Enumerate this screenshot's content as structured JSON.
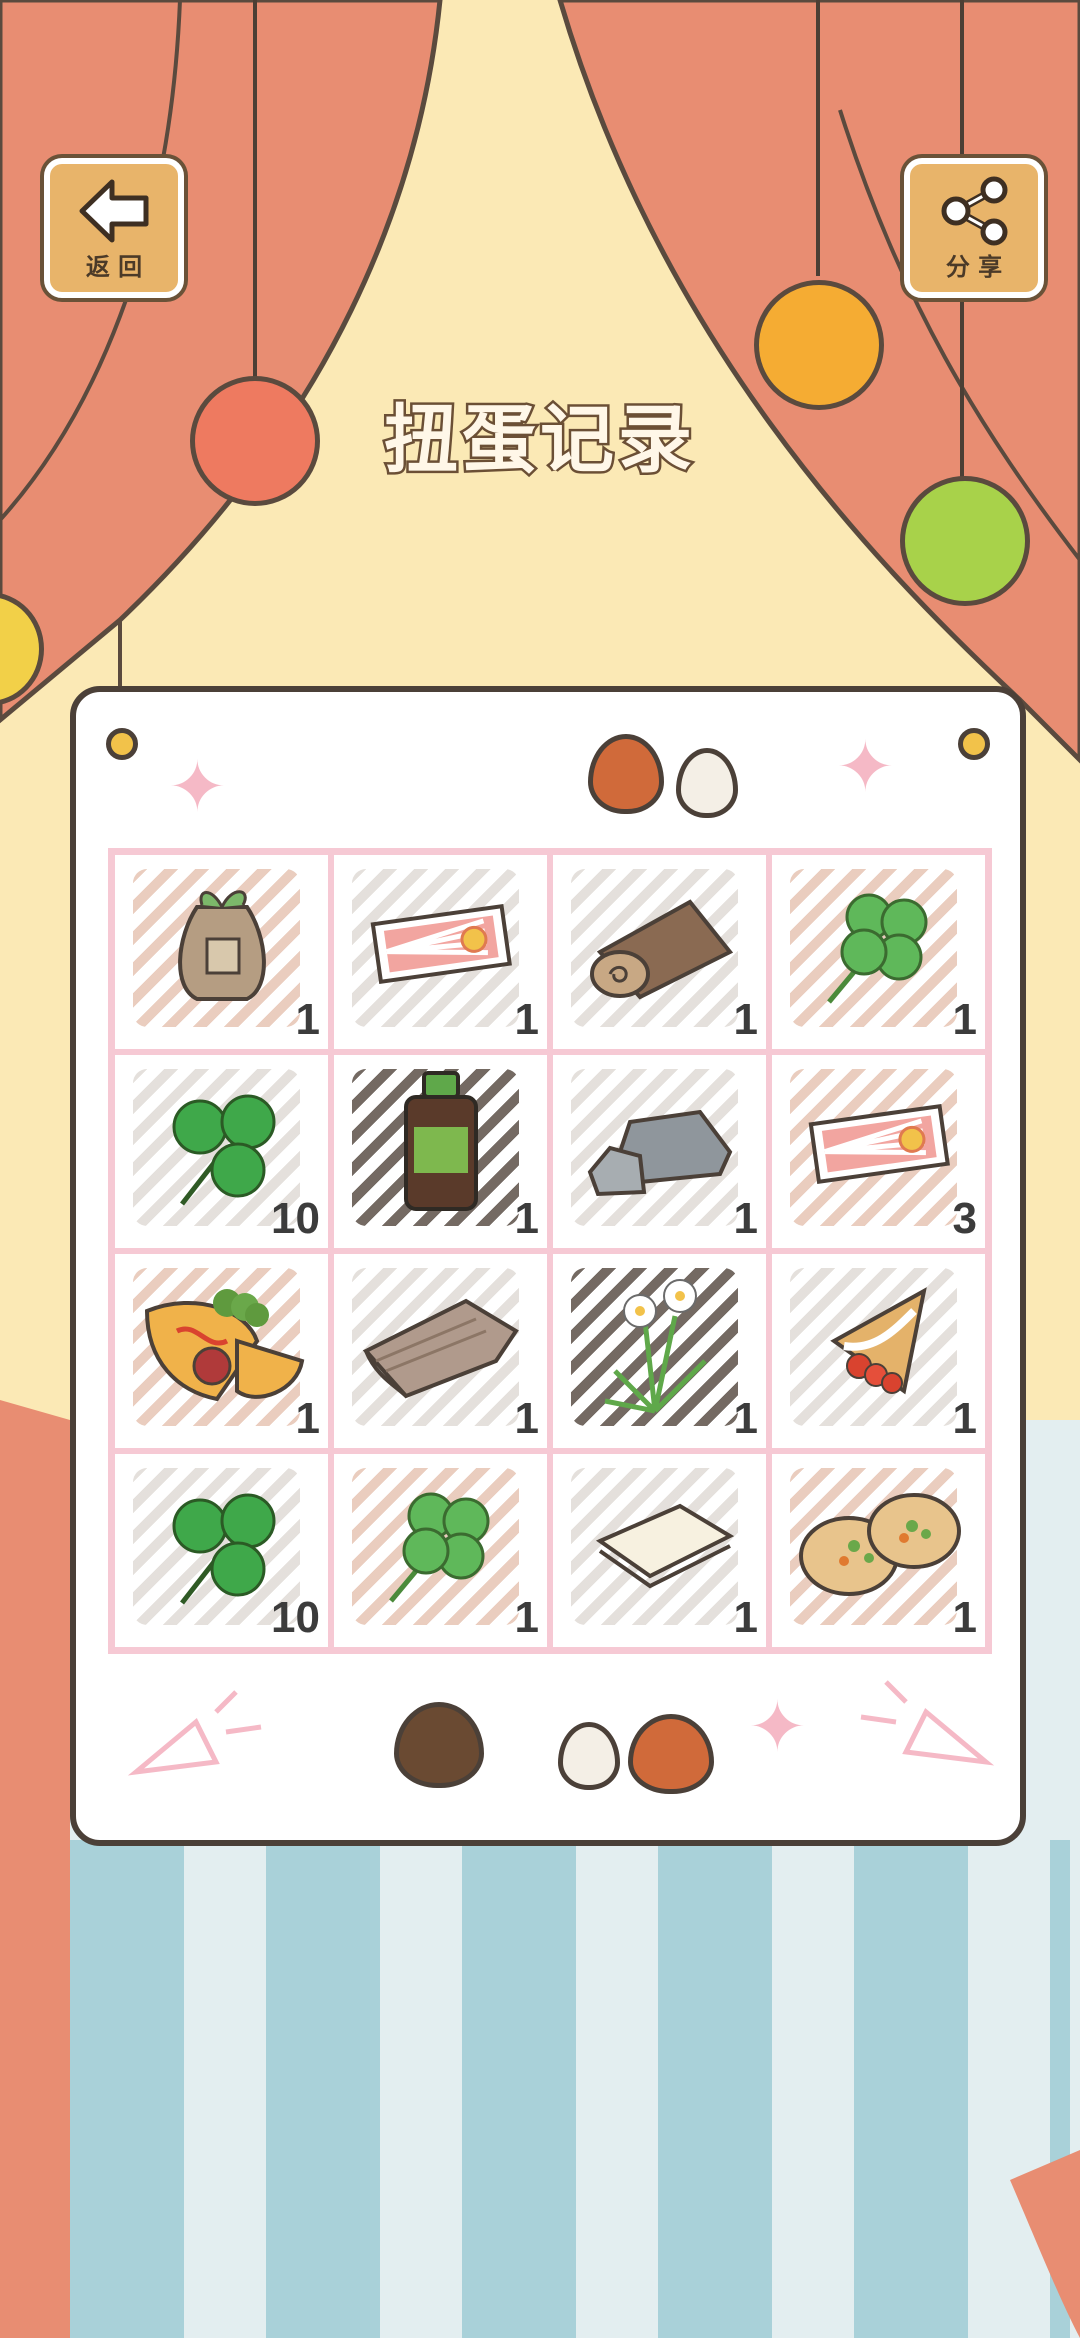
{
  "header": {
    "title": "扭蛋记录",
    "back_label": "返 回",
    "share_label": "分 享"
  },
  "icons": {
    "back": "arrow-left-icon",
    "share": "share-icon"
  },
  "colors": {
    "curtain": "#e88d72",
    "wall": "#fbe9b5",
    "board": "#ffffff",
    "grid_border": "#f6c9d4",
    "button_wood": "#e8b46a"
  },
  "collection": [
    {
      "item": "seed-bag",
      "count": "1"
    },
    {
      "item": "ticket",
      "count": "1"
    },
    {
      "item": "log",
      "count": "1"
    },
    {
      "item": "four-leaf-clover",
      "count": "1"
    },
    {
      "item": "three-leaf-clover",
      "count": "10"
    },
    {
      "item": "medicine-bottle",
      "count": "1"
    },
    {
      "item": "stone",
      "count": "1"
    },
    {
      "item": "ticket",
      "count": "3"
    },
    {
      "item": "omelette",
      "count": "1"
    },
    {
      "item": "cloth",
      "count": "1"
    },
    {
      "item": "narcissus",
      "count": "1"
    },
    {
      "item": "crepe",
      "count": "1"
    },
    {
      "item": "three-leaf-clover",
      "count": "10"
    },
    {
      "item": "four-leaf-clover",
      "count": "1"
    },
    {
      "item": "paper",
      "count": "1"
    },
    {
      "item": "pita-bread",
      "count": "1"
    }
  ]
}
